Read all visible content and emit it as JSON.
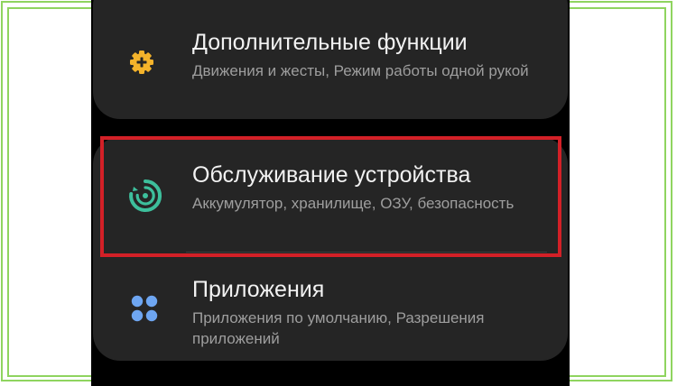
{
  "settings": {
    "items": [
      {
        "title": "Дополнительные функции",
        "subtitle": "Движения и жесты, Режим работы одной рукой",
        "icon": "gear-plus-icon",
        "icon_color": "#f4b32b"
      },
      {
        "title": "Обслуживание устройства",
        "subtitle": "Аккумулятор, хранилище, ОЗУ, безопасность",
        "icon": "device-care-icon",
        "icon_color": "#3dbf9c"
      },
      {
        "title": "Приложения",
        "subtitle": "Приложения по умолчанию, Разрешения приложений",
        "icon": "apps-grid-icon",
        "icon_color": "#6ea6f2"
      }
    ]
  },
  "colors": {
    "highlight": "#d32027",
    "frame": "#8fd45f",
    "card_bg": "#252525"
  }
}
